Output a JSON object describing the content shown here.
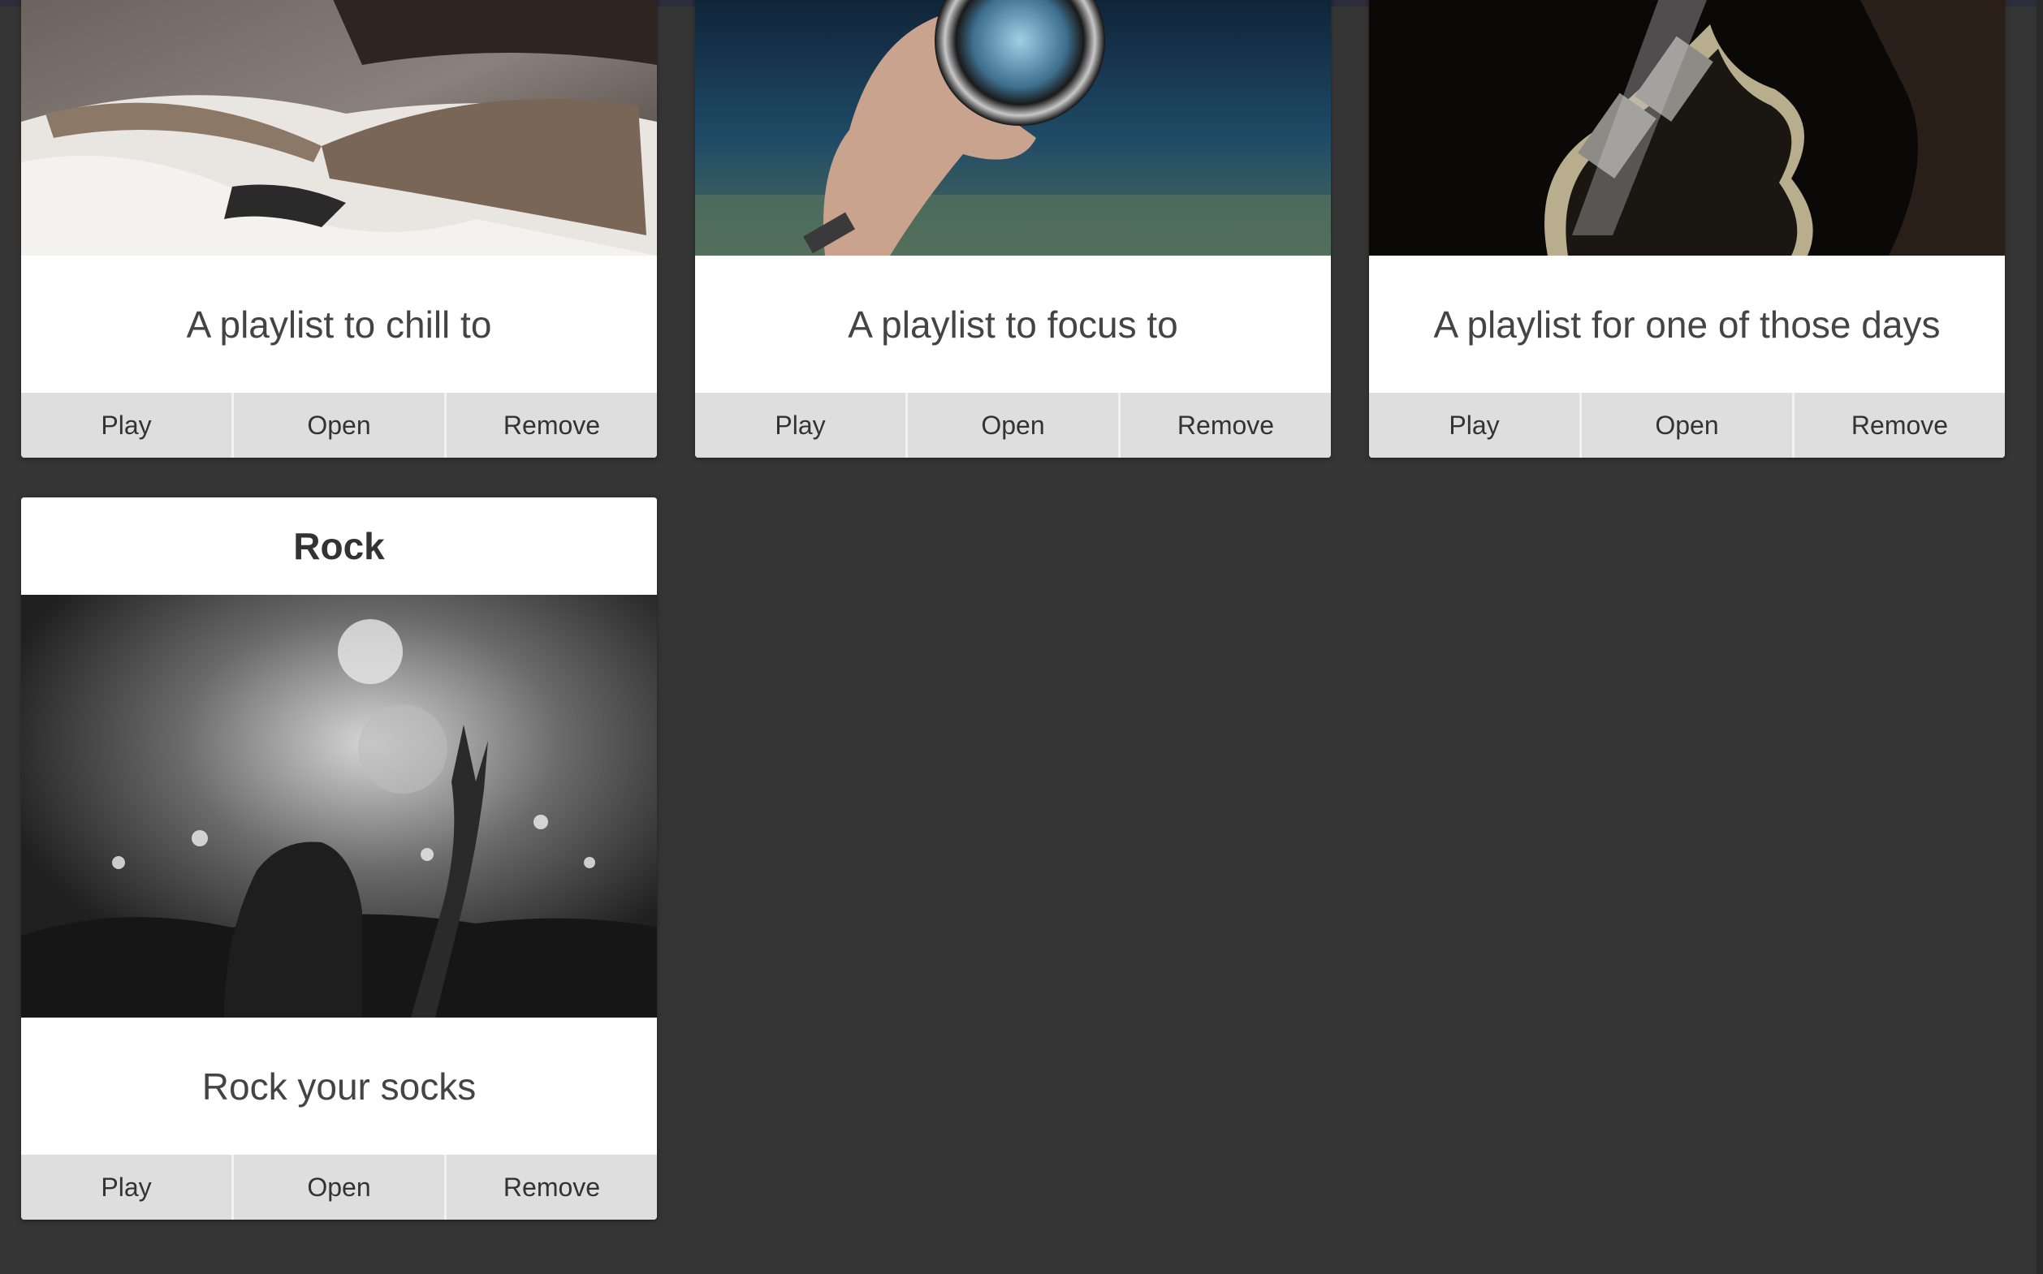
{
  "cards": [
    {
      "title": "",
      "description": "A playlist to chill to",
      "image": "book-on-blanket-photo",
      "actions": {
        "play": "Play",
        "open": "Open",
        "remove": "Remove"
      }
    },
    {
      "title": "",
      "description": "A playlist to focus to",
      "image": "lens-over-lake-photo",
      "actions": {
        "play": "Play",
        "open": "Open",
        "remove": "Remove"
      }
    },
    {
      "title": "",
      "description": "A playlist for one of those days",
      "image": "electric-guitar-photo",
      "actions": {
        "play": "Play",
        "open": "Open",
        "remove": "Remove"
      }
    },
    {
      "title": "Rock",
      "description": "Rock your socks",
      "image": "concert-crowd-photo",
      "actions": {
        "play": "Play",
        "open": "Open",
        "remove": "Remove"
      }
    }
  ]
}
